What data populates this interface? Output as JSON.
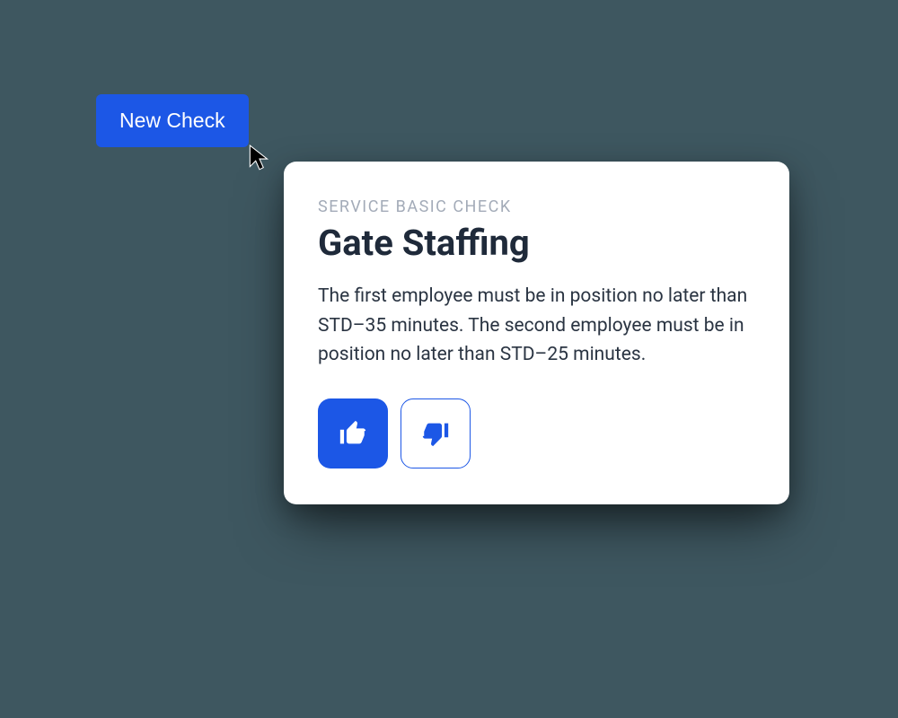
{
  "button": {
    "new_check_label": "New Check"
  },
  "card": {
    "category": "SERVICE BASIC CHECK",
    "title": "Gate Staffing",
    "description": "The first employee must be in position no later than STD–35 minutes. The second employee must be in position no later than STD–25 minutes."
  },
  "colors": {
    "accent": "#1c57e6",
    "background": "#3e5760",
    "card_bg": "#ffffff",
    "text_primary": "#1f2a3a",
    "text_muted": "#a3abb8"
  }
}
